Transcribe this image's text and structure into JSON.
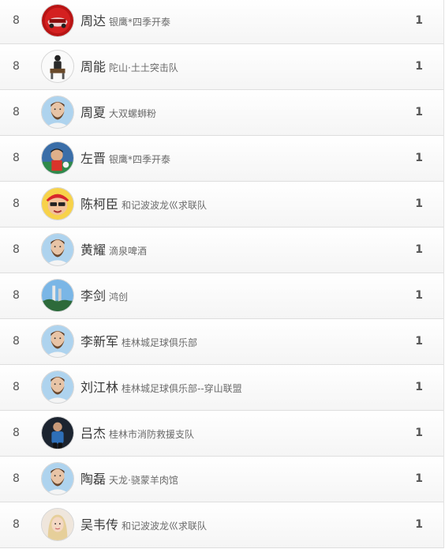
{
  "rows": [
    {
      "rank": "8",
      "name": "周达",
      "team": "银鹰*四季开泰",
      "count": "1",
      "avatar": "red-car-avatar"
    },
    {
      "rank": "8",
      "name": "周能",
      "team": "陀山·土土突击队",
      "count": "1",
      "avatar": "person-sitting-avatar"
    },
    {
      "rank": "8",
      "name": "周夏",
      "team": "大双螺蛳粉",
      "count": "1",
      "avatar": "bearded-man-avatar"
    },
    {
      "rank": "8",
      "name": "左晋",
      "team": "银鹰*四季开泰",
      "count": "1",
      "avatar": "child-photo-avatar"
    },
    {
      "rank": "8",
      "name": "陈柯臣",
      "team": "和记波波龙巛求联队",
      "count": "1",
      "avatar": "cartoon-avatar"
    },
    {
      "rank": "8",
      "name": "黄耀",
      "team": "滴泉啤酒",
      "count": "1",
      "avatar": "bearded-man-avatar"
    },
    {
      "rank": "8",
      "name": "李剑",
      "team": "鸿创",
      "count": "1",
      "avatar": "landscape-avatar"
    },
    {
      "rank": "8",
      "name": "李新军",
      "team": "桂林城足球俱乐部",
      "count": "1",
      "avatar": "bearded-man-avatar"
    },
    {
      "rank": "8",
      "name": "刘江林",
      "team": "桂林城足球俱乐部--穿山联盟",
      "count": "1",
      "avatar": "bearded-man-avatar"
    },
    {
      "rank": "8",
      "name": "吕杰",
      "team": "桂林市消防救援支队",
      "count": "1",
      "avatar": "player-photo-avatar"
    },
    {
      "rank": "8",
      "name": "陶磊",
      "team": "天龙·骁蒙羊肉馆",
      "count": "1",
      "avatar": "bearded-man-avatar"
    },
    {
      "rank": "8",
      "name": "吴韦传",
      "team": "和记波波龙巛求联队",
      "count": "1",
      "avatar": "girl-photo-avatar"
    }
  ]
}
